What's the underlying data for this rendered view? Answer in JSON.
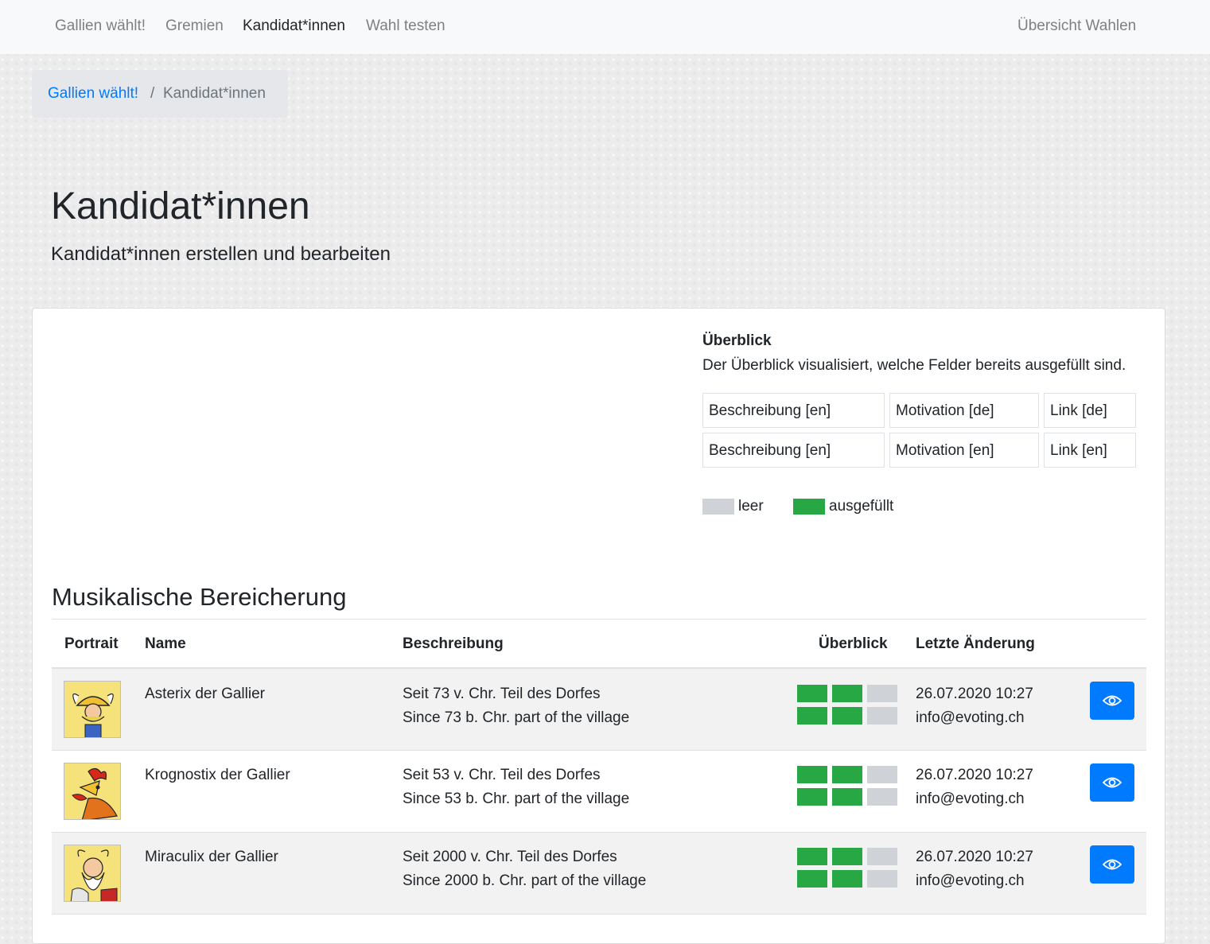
{
  "navbar": {
    "items": [
      {
        "label": "Gallien wählt!",
        "active": false
      },
      {
        "label": "Gremien",
        "active": false
      },
      {
        "label": "Kandidat*innen",
        "active": true
      },
      {
        "label": "Wahl testen",
        "active": false
      }
    ],
    "right_link": "Übersicht Wahlen"
  },
  "breadcrumb": {
    "home": "Gallien wählt!",
    "separator": "/",
    "current": "Kandidat*innen"
  },
  "page": {
    "title": "Kandidat*innen",
    "subtitle": "Kandidat*innen erstellen und bearbeiten"
  },
  "overview": {
    "title": "Überblick",
    "description": "Der Überblick visualisiert, welche Felder bereits ausgefüllt sind.",
    "fields_row1": [
      "Beschreibung [en]",
      "Motivation [de]",
      "Link [de]"
    ],
    "fields_row2": [
      "Beschreibung [en]",
      "Motivation [en]",
      "Link [en]"
    ],
    "legend": {
      "empty": "leer",
      "filled": "ausgefüllt"
    },
    "colors": {
      "filled": "#28a745",
      "empty": "#cfd3d7"
    }
  },
  "section": {
    "title": "Musikalische Bereicherung",
    "columns": {
      "portrait": "Portrait",
      "name": "Name",
      "description": "Beschreibung",
      "overview": "Überblick",
      "last_change": "Letzte Änderung"
    }
  },
  "candidates": [
    {
      "name": "Asterix der Gallier",
      "desc_de": "Seit 73 v. Chr. Teil des Dorfes",
      "desc_en": "Since 73 b. Chr. part of the village",
      "date": "26.07.2020 10:27",
      "email": "info@evoting.ch",
      "filled": [
        [
          true,
          true,
          false
        ],
        [
          true,
          true,
          false
        ]
      ]
    },
    {
      "name": "Krognostix der Gallier",
      "desc_de": "Seit 53 v. Chr. Teil des Dorfes",
      "desc_en": "Since 53 b. Chr. part of the village",
      "date": "26.07.2020 10:27",
      "email": "info@evoting.ch",
      "filled": [
        [
          true,
          true,
          false
        ],
        [
          true,
          true,
          false
        ]
      ]
    },
    {
      "name": "Miraculix der Gallier",
      "desc_de": "Seit 2000 v. Chr. Teil des Dorfes",
      "desc_en": "Since 2000 b. Chr. part of the village",
      "date": "26.07.2020 10:27",
      "email": "info@evoting.ch",
      "filled": [
        [
          true,
          true,
          false
        ],
        [
          true,
          true,
          false
        ]
      ]
    }
  ],
  "icons": {
    "view": "eye-icon"
  },
  "accent_color": "#007bff"
}
